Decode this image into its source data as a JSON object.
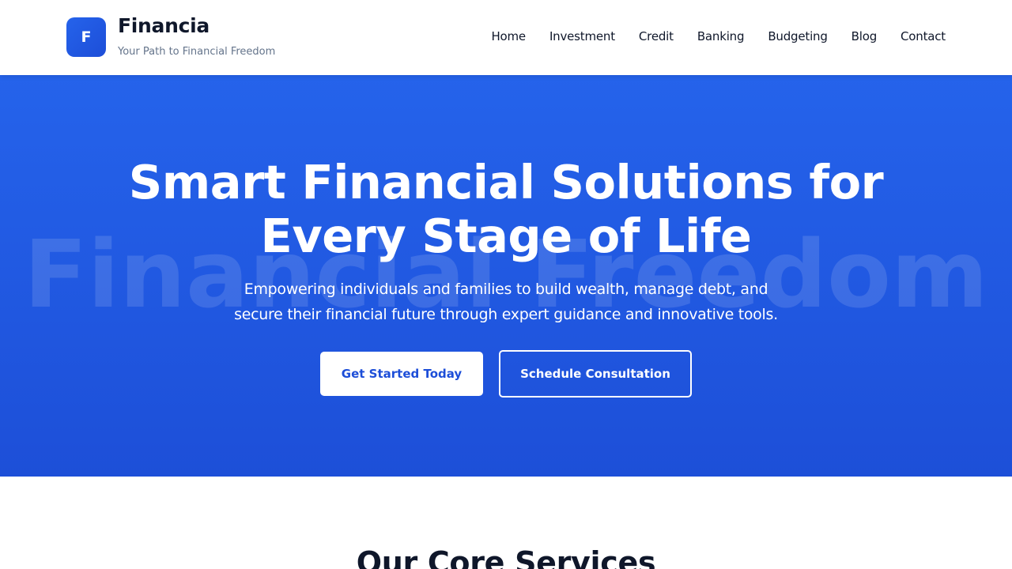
{
  "header": {
    "logo_letter": "F",
    "brand_name": "Financia",
    "tagline": "Your Path to Financial Freedom",
    "nav": [
      "Home",
      "Investment",
      "Credit",
      "Banking",
      "Budgeting",
      "Blog",
      "Contact"
    ]
  },
  "hero": {
    "watermark": "Financial Freedom",
    "title": "Smart Financial Solutions for Every Stage of Life",
    "subtitle": "Empowering individuals and families to build wealth, manage debt, and secure their financial future through expert guidance and innovative tools.",
    "primary_button": "Get Started Today",
    "secondary_button": "Schedule Consultation"
  },
  "services": {
    "title": "Our Core Services"
  },
  "colors": {
    "brand_blue": "#2563eb",
    "dark_text": "#0f172a",
    "muted_text": "#64748b"
  }
}
